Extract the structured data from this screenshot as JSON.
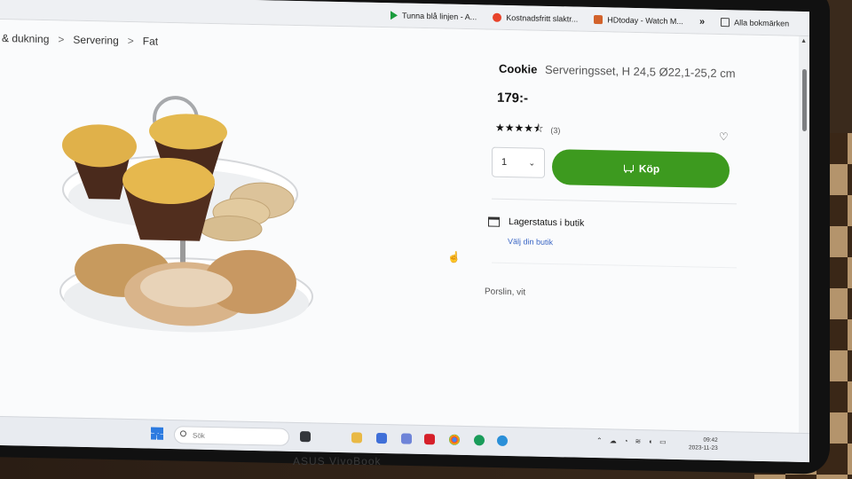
{
  "bookmarks": {
    "items": [
      {
        "label": "Tunna blå linjen - A...",
        "icon": "play-icon"
      },
      {
        "label": "Kostnadsfritt slaktr...",
        "icon": "record-icon"
      },
      {
        "label": "HDtoday - Watch M...",
        "icon": "hd-icon"
      }
    ],
    "more": "»",
    "all_bookmarks": "Alla bokmärken"
  },
  "breadcrumb": {
    "items": [
      "& dukning",
      "Servering",
      "Fat"
    ],
    "separator": ">"
  },
  "product": {
    "name": "Cookie",
    "description": "Serveringsset, H 24,5 Ø22,1-25,2 cm",
    "price": "179:-",
    "rating_stars": "★★★★⯪",
    "rating_value": 4.5,
    "rating_count": "(3)",
    "quantity": "1",
    "buy_label": "Köp",
    "store_status": "Lagerstatus i butik",
    "choose_store": "Välj din butik",
    "material": "Porslin, vit"
  },
  "taskbar": {
    "search_placeholder": "Sök",
    "time": "09:42",
    "date": "2023-11-23"
  },
  "device": {
    "brand": "ASUS VivoBook"
  },
  "colors": {
    "buy_button": "#3d9a1f",
    "link": "#3a66c4"
  }
}
